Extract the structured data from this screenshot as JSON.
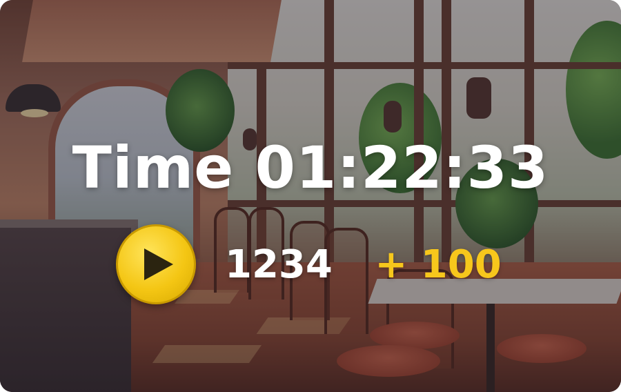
{
  "timer": {
    "label": "Time",
    "value": "01:22:33"
  },
  "controls": {
    "play_icon": "play-icon"
  },
  "score": {
    "current": "1234",
    "bonus": "+ 100"
  },
  "colors": {
    "accent": "#f4c614",
    "bonus_text": "#f7c71c",
    "text": "#ffffff",
    "play_glyph": "#2b2410"
  }
}
